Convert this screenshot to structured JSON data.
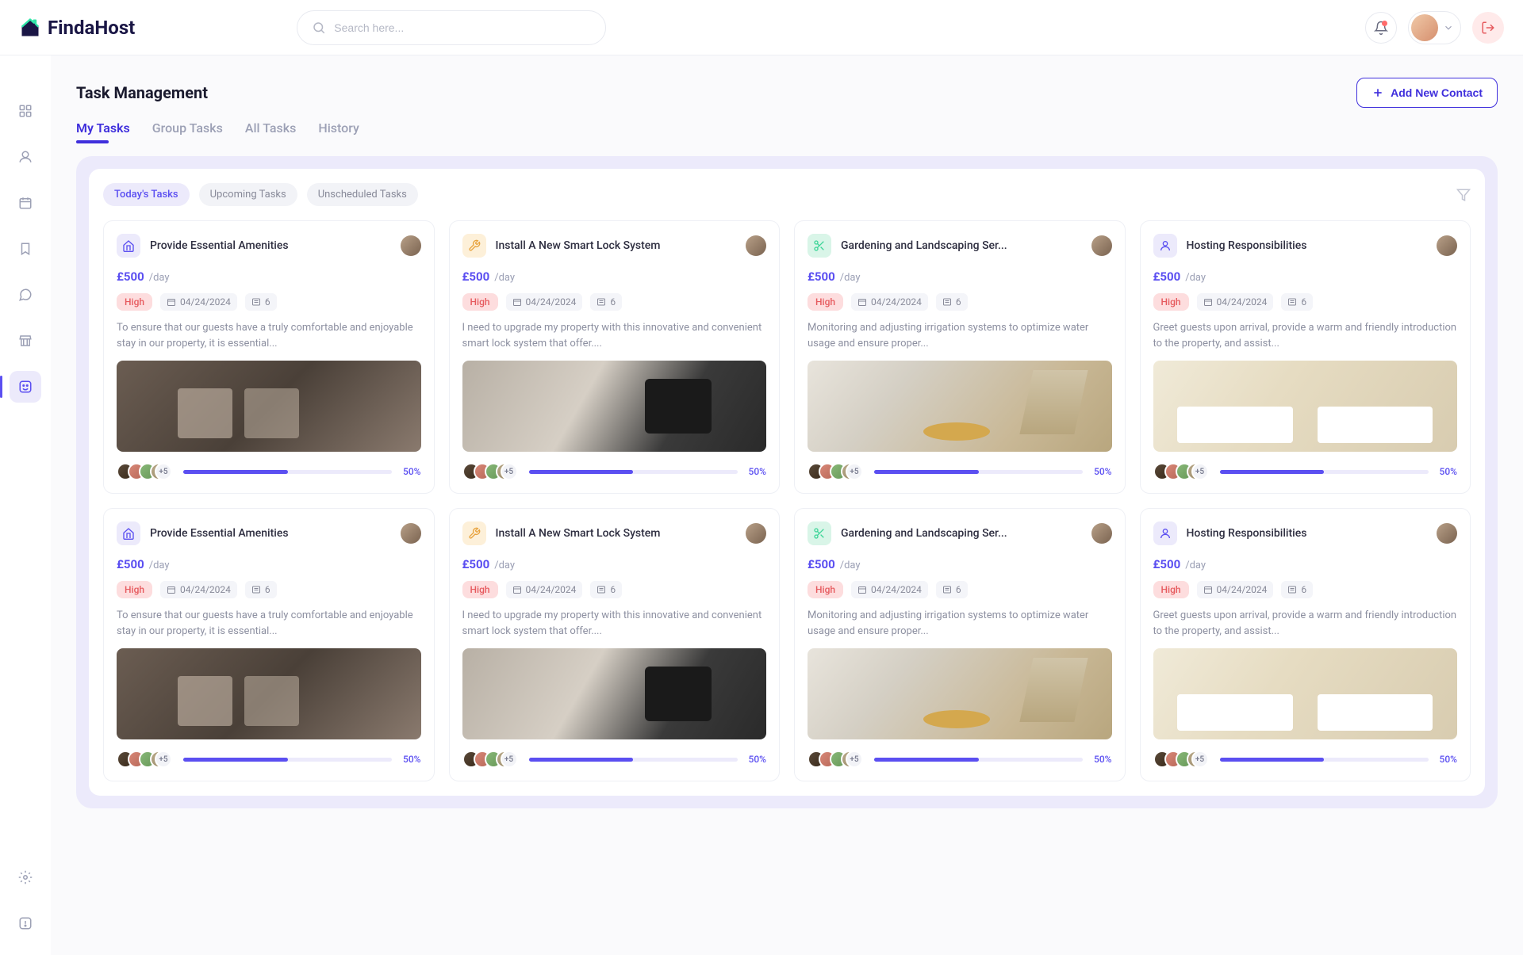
{
  "brand": "FindaHost",
  "search": {
    "placeholder": "Search here..."
  },
  "page": {
    "title": "Task Management"
  },
  "addButton": {
    "label": "Add New Contact"
  },
  "tabs": [
    {
      "label": "My Tasks",
      "active": true
    },
    {
      "label": "Group Tasks"
    },
    {
      "label": "All Tasks"
    },
    {
      "label": "History"
    }
  ],
  "subTabs": [
    {
      "label": "Today's Tasks",
      "active": true
    },
    {
      "label": "Upcoming Tasks"
    },
    {
      "label": "Unscheduled Tasks"
    }
  ],
  "priorityLabel": "High",
  "moreAvatars": "+5",
  "cards": [
    {
      "icon": "home",
      "iconClass": "purple",
      "imgClass": "img-amenities",
      "title": "Provide Essential Amenities",
      "price": "£500",
      "unit": "/day",
      "date": "04/24/2024",
      "count": "6",
      "desc": "To ensure that our guests have a truly comfortable and enjoyable stay in our property, it is essential...",
      "progress": "50%"
    },
    {
      "icon": "tools",
      "iconClass": "yellow",
      "imgClass": "img-lock",
      "title": "Install A New Smart Lock System",
      "price": "£500",
      "unit": "/day",
      "date": "04/24/2024",
      "count": "6",
      "desc": "I need to upgrade my property with this innovative and convenient smart lock system that offer....",
      "progress": "50%"
    },
    {
      "icon": "scissors",
      "iconClass": "green",
      "imgClass": "img-garden",
      "title": "Gardening and Landscaping Ser...",
      "price": "£500",
      "unit": "/day",
      "date": "04/24/2024",
      "count": "6",
      "desc": "Monitoring and adjusting irrigation systems to optimize water usage and ensure proper...",
      "progress": "50%"
    },
    {
      "icon": "person",
      "iconClass": "purple",
      "imgClass": "img-hosting",
      "title": "Hosting Responsibilities",
      "price": "£500",
      "unit": "/day",
      "date": "04/24/2024",
      "count": "6",
      "desc": "Greet guests upon arrival, provide a warm and friendly introduction to the property, and assist...",
      "progress": "50%"
    },
    {
      "icon": "home",
      "iconClass": "purple",
      "imgClass": "img-amenities",
      "title": "Provide Essential Amenities",
      "price": "£500",
      "unit": "/day",
      "date": "04/24/2024",
      "count": "6",
      "desc": "To ensure that our guests have a truly comfortable and enjoyable stay in our property, it is essential...",
      "progress": "50%"
    },
    {
      "icon": "tools",
      "iconClass": "yellow",
      "imgClass": "img-lock",
      "title": "Install A New Smart Lock System",
      "price": "£500",
      "unit": "/day",
      "date": "04/24/2024",
      "count": "6",
      "desc": "I need to upgrade my property with this innovative and convenient smart lock system that offer....",
      "progress": "50%"
    },
    {
      "icon": "scissors",
      "iconClass": "green",
      "imgClass": "img-garden",
      "title": "Gardening and Landscaping Ser...",
      "price": "£500",
      "unit": "/day",
      "date": "04/24/2024",
      "count": "6",
      "desc": "Monitoring and adjusting irrigation systems to optimize water usage and ensure proper...",
      "progress": "50%"
    },
    {
      "icon": "person",
      "iconClass": "purple",
      "imgClass": "img-hosting",
      "title": "Hosting Responsibilities",
      "price": "£500",
      "unit": "/day",
      "date": "04/24/2024",
      "count": "6",
      "desc": "Greet guests upon arrival, provide a warm and friendly introduction to the property, and assist...",
      "progress": "50%"
    }
  ]
}
